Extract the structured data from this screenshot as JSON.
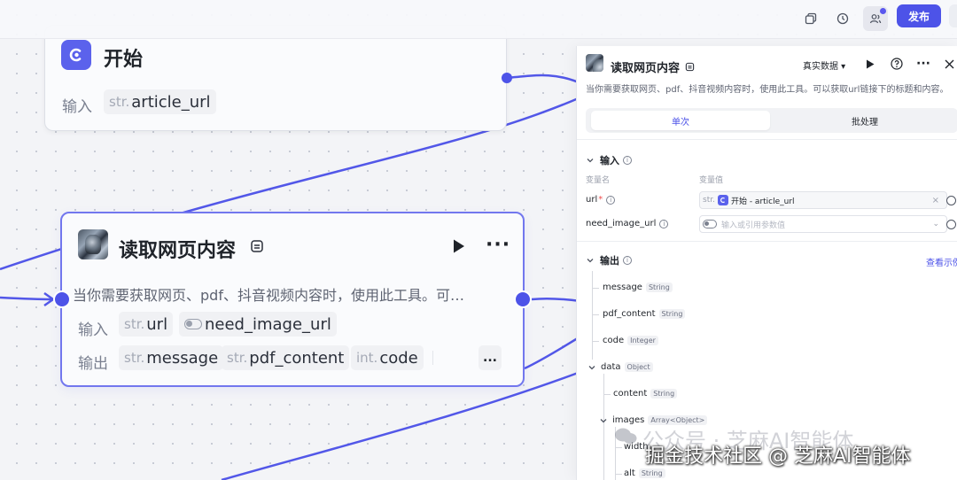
{
  "topbar": {
    "publish_label": "发布",
    "icons": [
      "copy-icon",
      "history-icon",
      "collaborators-icon"
    ]
  },
  "start_node": {
    "title": "开始",
    "input_label": "输入",
    "param_type": "str.",
    "param_name": "article_url"
  },
  "read_node": {
    "title": "读取网页内容",
    "description": "当你需要获取网页、pdf、抖音视频内容时，使用此工具。可…",
    "input_label": "输入",
    "output_label": "输出",
    "inputs": [
      {
        "type": "str.",
        "name": "url"
      },
      {
        "type": "toggle",
        "name": "need_image_url"
      }
    ],
    "outputs": [
      {
        "type": "str.",
        "name": "message"
      },
      {
        "type": "str.",
        "name": "pdf_content"
      },
      {
        "type": "int.",
        "name": "code"
      }
    ],
    "more": "..."
  },
  "panel": {
    "title": "读取网页内容",
    "mode": "真实数据",
    "description": "当你需要获取网页、pdf、抖音视频内容时，使用此工具。可以获取url链接下的标题和内容。",
    "tabs": {
      "single": "单次",
      "batch": "批处理"
    },
    "input_section": "输入",
    "col_name": "变量名",
    "col_value": "变量值",
    "url_var": "url",
    "url_required": "*",
    "url_type": "str.",
    "url_ref": "开始 - article_url",
    "need_image_var": "need_image_url",
    "need_image_placeholder": "输入或引用参数值",
    "output_section": "输出",
    "view_example": "查看示例",
    "outputs": {
      "message": {
        "name": "message",
        "type": "String"
      },
      "pdf_content": {
        "name": "pdf_content",
        "type": "String"
      },
      "code": {
        "name": "code",
        "type": "Integer"
      },
      "data": {
        "name": "data",
        "type": "Object"
      },
      "content": {
        "name": "content",
        "type": "String"
      },
      "images": {
        "name": "images",
        "type": "Array<Object>"
      },
      "width": {
        "name": "width",
        "type": ""
      },
      "alt": {
        "name": "alt",
        "type": "String"
      }
    }
  },
  "watermark": {
    "faint": "公众号 · 芝麻AI智能体",
    "strong": "掘金技术社区 @ 芝麻AI智能体"
  }
}
